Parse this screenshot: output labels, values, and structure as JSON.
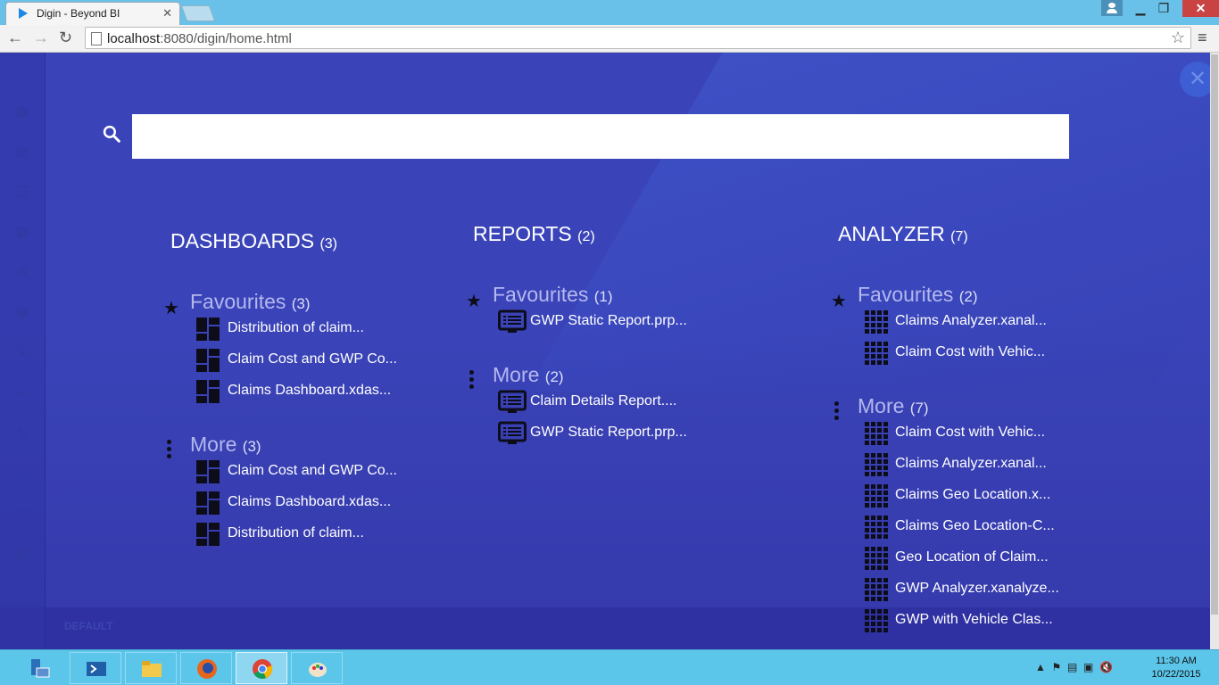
{
  "browser": {
    "tab_title": "Digin - Beyond BI",
    "url_host": "localhost",
    "url_path": ":8080/digin/home.html"
  },
  "search": {
    "placeholder": "",
    "value": ""
  },
  "sidebar_footer": "DEFAULT",
  "sections": [
    {
      "title": "DASHBOARDS",
      "count": "(3)",
      "icon": "dashboard-icon",
      "favourites": {
        "label": "Favourites",
        "count": "(3)",
        "items": [
          "Distribution of claim...",
          "Claim Cost and GWP Co...",
          "Claims Dashboard.xdas..."
        ]
      },
      "more": {
        "label": "More",
        "count": "(3)",
        "items": [
          "Claim Cost and GWP Co...",
          "Claims Dashboard.xdas...",
          "Distribution of claim..."
        ]
      }
    },
    {
      "title": "REPORTS",
      "count": "(2)",
      "icon": "report-icon",
      "favourites": {
        "label": "Favourites",
        "count": "(1)",
        "items": [
          "GWP Static Report.prp..."
        ]
      },
      "more": {
        "label": "More",
        "count": "(2)",
        "items": [
          "Claim Details Report....",
          "GWP Static Report.prp..."
        ]
      }
    },
    {
      "title": "ANALYZER",
      "count": "(7)",
      "icon": "grid-icon",
      "favourites": {
        "label": "Favourites",
        "count": "(2)",
        "items": [
          "Claims Analyzer.xanal...",
          "Claim Cost with Vehic..."
        ]
      },
      "more": {
        "label": "More",
        "count": "(7)",
        "items": [
          "Claim Cost with Vehic...",
          "Claims Analyzer.xanal...",
          "Claims Geo Location.x...",
          "Claims Geo Location-C...",
          "Geo Location of Claim...",
          "GWP Analyzer.xanalyze...",
          "GWP with Vehicle Clas..."
        ]
      }
    }
  ],
  "taskbar": {
    "clock_time": "11:30 AM",
    "clock_date": "10/22/2015"
  },
  "colors": {
    "app_bg": "#3a44b8",
    "heading": "#ffffff",
    "group_title": "#b3b8ee",
    "taskbar": "#5cc6ea"
  }
}
